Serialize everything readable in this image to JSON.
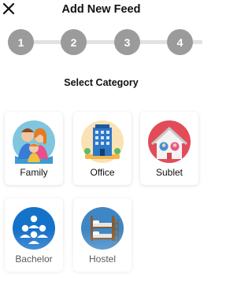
{
  "header": {
    "title": "Add New Feed",
    "close_icon": "close-icon"
  },
  "stepper": {
    "steps": [
      "1",
      "2",
      "3",
      "4"
    ],
    "active": 1
  },
  "section": {
    "title": "Select Category"
  },
  "categories": [
    {
      "label": "Family",
      "icon": "family-icon"
    },
    {
      "label": "Office",
      "icon": "office-building-icon"
    },
    {
      "label": "Sublet",
      "icon": "sublet-house-icon"
    },
    {
      "label": "Bachelor",
      "icon": "bachelor-group-icon"
    },
    {
      "label": "Hostel",
      "icon": "hostel-bunk-bed-icon"
    }
  ],
  "colors": {
    "step": "#9b9b9b",
    "step_line": "#e2e2e2",
    "accent_blue": "#1572c9"
  }
}
